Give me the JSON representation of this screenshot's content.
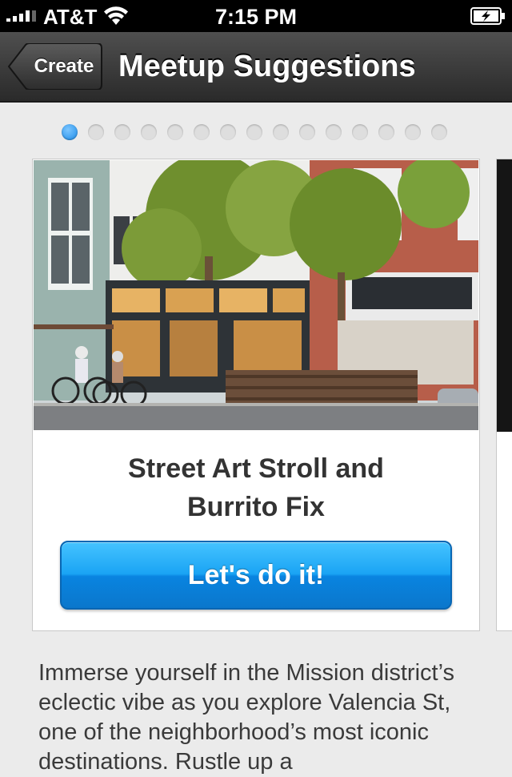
{
  "status_bar": {
    "carrier": "AT&T",
    "time": "7:15 PM"
  },
  "nav": {
    "back_label": "Create",
    "title": "Meetup Suggestions"
  },
  "pager": {
    "total": 15,
    "active_index": 0
  },
  "card": {
    "title_line1": "Street Art Stroll and",
    "title_line2": "Burrito Fix",
    "button_label": "Let's do it!",
    "image_subject": "storefront-with-trees-and-cyclists"
  },
  "description": "Immerse yourself in the Mission district’s eclectic vibe as you explore Valencia St, one of the neighborhood’s most iconic destinations. Rustle up a",
  "colors": {
    "accent": "#1a9af0",
    "nav_bar": "#3a3a3a",
    "background": "#ebebeb"
  }
}
